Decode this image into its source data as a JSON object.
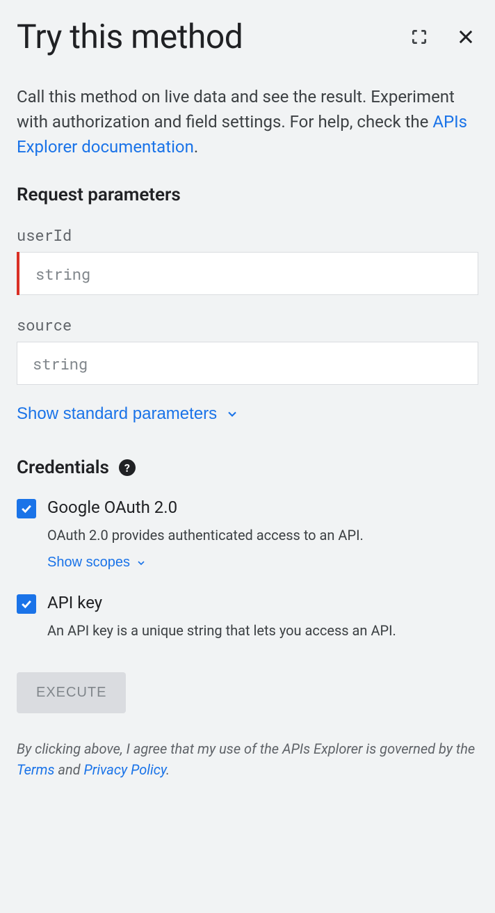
{
  "header": {
    "title": "Try this method"
  },
  "description": {
    "text_before_link": "Call this method on live data and see the result. Experiment with authorization and field settings. For help, check the ",
    "link_text": "APIs Explorer documentation",
    "text_after_link": "."
  },
  "request_params": {
    "heading": "Request parameters",
    "params": [
      {
        "name": "userId",
        "placeholder": "string",
        "required": true
      },
      {
        "name": "source",
        "placeholder": "string",
        "required": false
      }
    ],
    "show_standard_label": "Show standard parameters"
  },
  "credentials": {
    "heading": "Credentials",
    "oauth": {
      "label": "Google OAuth 2.0",
      "checked": true,
      "description": "OAuth 2.0 provides authenticated access to an API.",
      "show_scopes_label": "Show scopes"
    },
    "apikey": {
      "label": "API key",
      "checked": true,
      "description": "An API key is a unique string that lets you access an API."
    }
  },
  "execute": {
    "label": "EXECUTE"
  },
  "disclaimer": {
    "text_before": "By clicking above, I agree that my use of the APIs Explorer is governed by the ",
    "terms_label": "Terms",
    "and_text": " and ",
    "privacy_label": "Privacy Policy",
    "text_after": "."
  }
}
